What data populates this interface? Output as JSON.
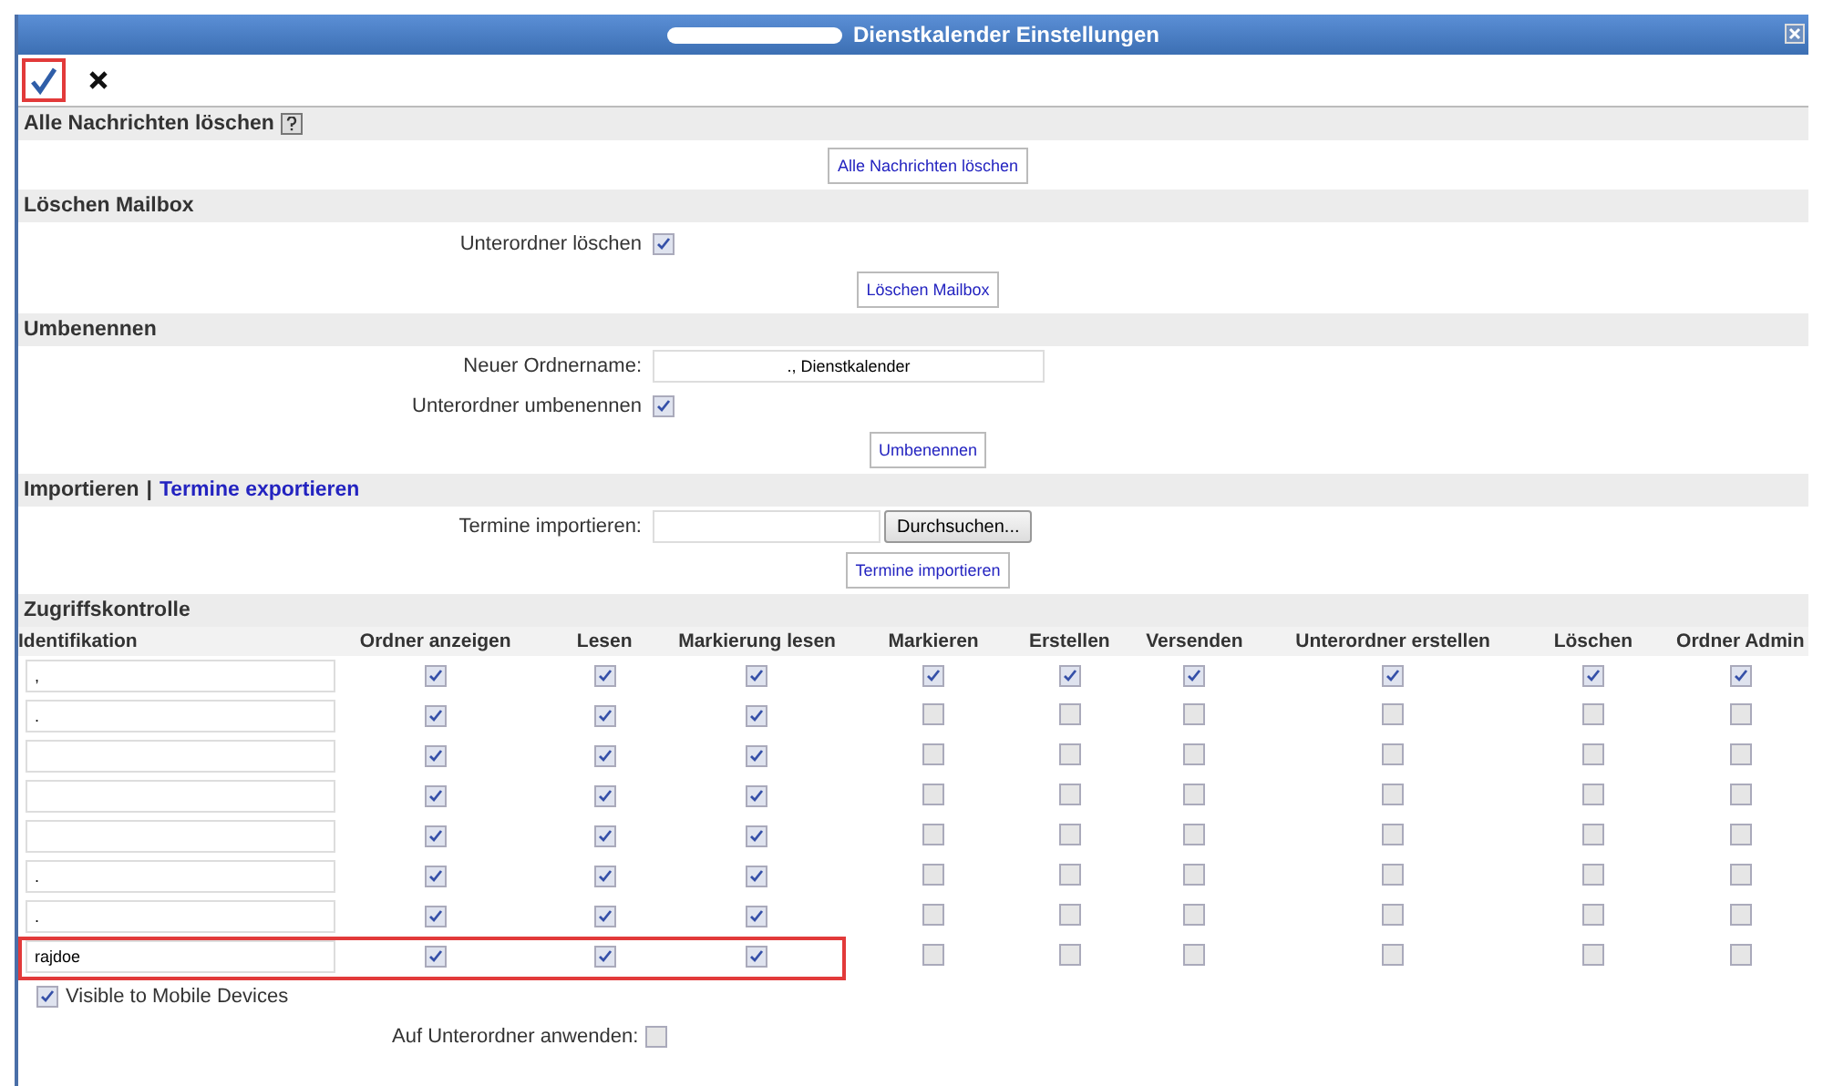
{
  "window": {
    "title": "Dienstkalender Einstellungen"
  },
  "toolbar": [
    {
      "kind": "confirm",
      "highlighted": true
    },
    {
      "kind": "cancel",
      "highlighted": false
    }
  ],
  "delete_messages": {
    "title": "Alle Nachrichten löschen",
    "button": "Alle Nachrichten löschen"
  },
  "delete_mailbox": {
    "title": "Löschen Mailbox",
    "subfolders_label": "Unterordner löschen",
    "subfolders_checked": true,
    "button": "Löschen Mailbox"
  },
  "rename": {
    "title": "Umbenennen",
    "name_label": "Neuer Ordnername:",
    "name_value": "., Dienstkalender",
    "subfolders_label": "Unterordner umbenennen",
    "subfolders_checked": true,
    "button": "Umbenennen"
  },
  "import": {
    "title": "Importieren",
    "separator": "|",
    "export_link": "Termine exportieren",
    "file_label": "Termine importieren:",
    "browse_button": "Durchsuchen...",
    "button": "Termine importieren"
  },
  "access": {
    "title": "Zugriffskontrolle",
    "columns": [
      "Identifikation",
      "Ordner anzeigen",
      "Lesen",
      "Markierung lesen",
      "Markieren",
      "Erstellen",
      "Versenden",
      "Unterordner erstellen",
      "Löschen",
      "Ordner Admin"
    ],
    "rows": [
      {
        "identity": ",",
        "highlighted": false,
        "rights": [
          true,
          true,
          true,
          true,
          true,
          true,
          true,
          true,
          true
        ]
      },
      {
        "identity": ".",
        "highlighted": false,
        "rights": [
          true,
          true,
          true,
          false,
          false,
          false,
          false,
          false,
          false
        ]
      },
      {
        "highlighted": false,
        "rights": [
          true,
          true,
          true,
          false,
          false,
          false,
          false,
          false,
          false
        ]
      },
      {
        "highlighted": false,
        "rights": [
          true,
          true,
          true,
          false,
          false,
          false,
          false,
          false,
          false
        ]
      },
      {
        "highlighted": false,
        "rights": [
          true,
          true,
          true,
          false,
          false,
          false,
          false,
          false,
          false
        ]
      },
      {
        "identity": ".",
        "highlighted": false,
        "rights": [
          true,
          true,
          true,
          false,
          false,
          false,
          false,
          false,
          false
        ]
      },
      {
        "identity": ".",
        "highlighted": false,
        "rights": [
          true,
          true,
          true,
          false,
          false,
          false,
          false,
          false,
          false
        ]
      },
      {
        "identity": "rajdoe",
        "highlighted": true,
        "rights": [
          true,
          true,
          true,
          false,
          false,
          false,
          false,
          false,
          false
        ]
      }
    ],
    "mobile_label": "Visible to Mobile Devices",
    "mobile_checked": true,
    "apply_label": "Auf Unterordner anwenden:",
    "apply_checked": false
  }
}
